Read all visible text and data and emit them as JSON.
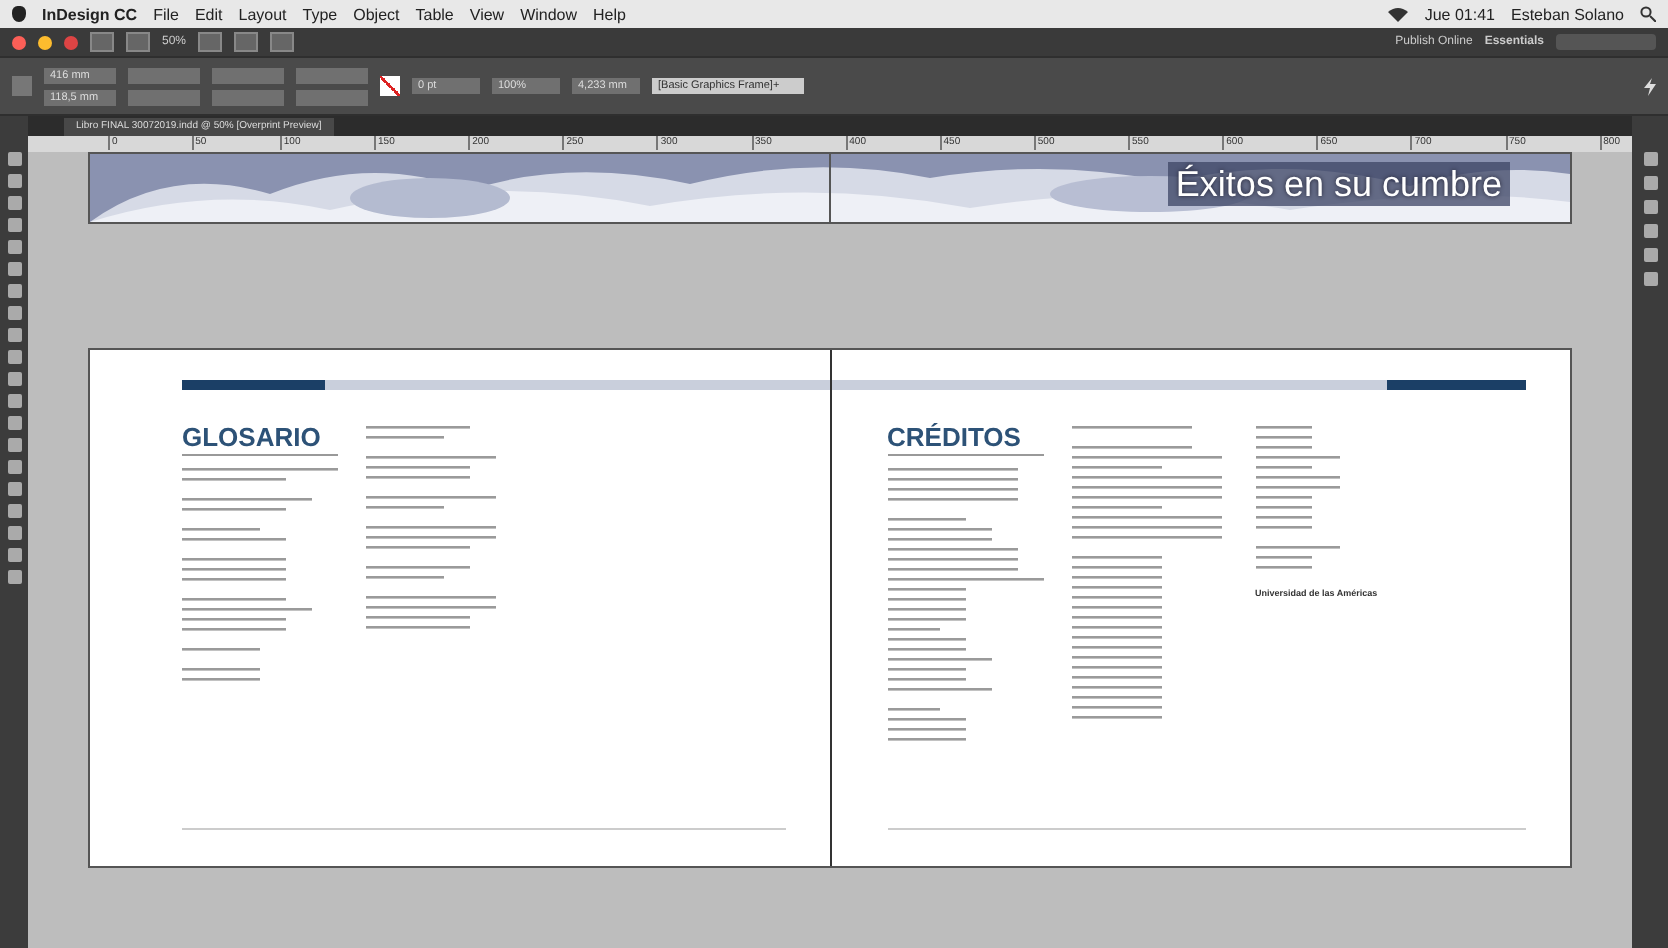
{
  "menu_bar": {
    "app": "InDesign CC",
    "items": [
      "File",
      "Edit",
      "Layout",
      "Type",
      "Object",
      "Table",
      "View",
      "Window",
      "Help"
    ],
    "clock": "Jue 01:41",
    "user": "Esteban Solano"
  },
  "app_bar": {
    "zoom": "50%",
    "publish": "Publish Online",
    "workspace": "Essentials"
  },
  "control_panel": {
    "x": "416 mm",
    "y": "118,5 mm",
    "stroke": "0 pt",
    "opacity": "100%",
    "measure": "4,233 mm",
    "style": "[Basic Graphics Frame]+"
  },
  "document_tab": {
    "title": "Libro FINAL 30072019.indd @ 50% [Overprint Preview]"
  },
  "ruler": {
    "ticks": [
      "0",
      "50",
      "100",
      "150",
      "200",
      "250",
      "300",
      "350",
      "400",
      "450",
      "500",
      "550",
      "600",
      "650",
      "700",
      "750",
      "800"
    ]
  },
  "banner": {
    "title": "Éxitos en su cumbre"
  },
  "pages": [
    {
      "title": "GLOSARIO",
      "kind": "glossary"
    },
    {
      "title": "CRÉDITOS",
      "kind": "credits",
      "note": "Universidad de las Américas"
    }
  ]
}
